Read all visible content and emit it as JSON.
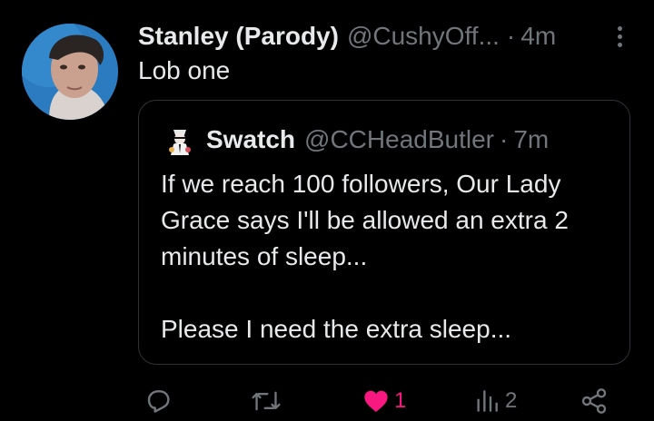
{
  "post": {
    "display_name": "Stanley (Parody)",
    "handle": "@CushyOff...",
    "separator": "·",
    "time": "4m",
    "text": "Lob one"
  },
  "quoted_post": {
    "display_name": "Swatch",
    "handle": "@CCHeadButler",
    "separator": "·",
    "time": "7m",
    "paragraphs": [
      "If we reach 100 followers, Our Lady",
      "Grace says I'll be allowed an extra 2",
      "minutes of sleep...",
      "Please I need the extra sleep..."
    ]
  },
  "actions": {
    "like_count": "1",
    "views_count": "2"
  },
  "colors": {
    "background": "#000000",
    "primary_text": "#e7e9ea",
    "secondary_text": "#71767b",
    "border": "#2f3336",
    "like_pink": "#f91880"
  },
  "icons": {
    "more": "more-vertical-icon",
    "reply": "reply-icon",
    "repost": "repost-icon",
    "like": "heart-filled-icon",
    "views": "views-icon",
    "share": "share-icon"
  }
}
